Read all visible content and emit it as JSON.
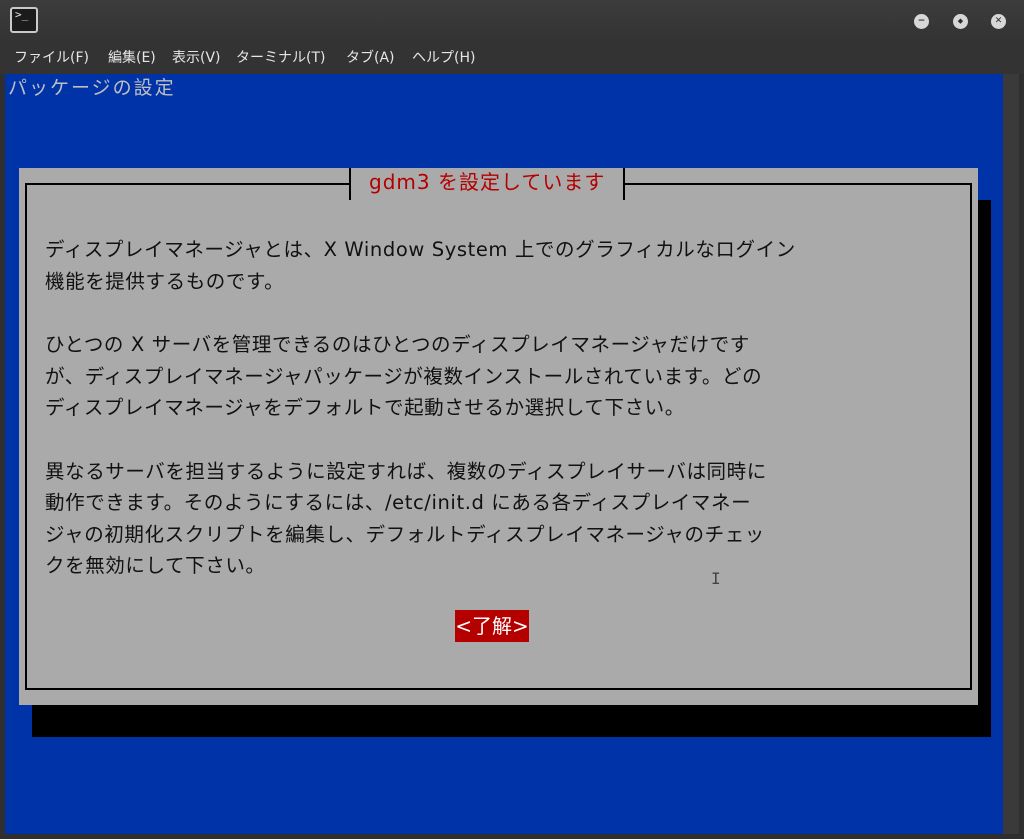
{
  "window": {
    "icon_glyph": ">_",
    "controls": {
      "minimize_glyph": "−",
      "maximize_glyph": "◆",
      "close_glyph": "✕"
    }
  },
  "menubar": {
    "items": [
      {
        "label": "ファイル(F)"
      },
      {
        "label": "編集(E)"
      },
      {
        "label": "表示(V)"
      },
      {
        "label": "ターミナル(T)"
      },
      {
        "label": "タブ(A)"
      },
      {
        "label": "ヘルプ(H)"
      }
    ]
  },
  "terminal": {
    "backtitle": "パッケージの設定",
    "dialog": {
      "title": "gdm3 を設定しています",
      "paragraphs": [
        "ディスプレイマネージャとは、X Window System 上でのグラフィカルなログイン\n機能を提供するものです。",
        "ひとつの X サーバを管理できるのはひとつのディスプレイマネージャだけです\nが、ディスプレイマネージャパッケージが複数インストールされています。どの\nディスプレイマネージャをデフォルトで起動させるか選択して下さい。",
        "異なるサーバを担当するように設定すれば、複数のディスプレイサーバは同時に\n動作できます。そのようにするには、/etc/init.d にある各ディスプレイマネー\nジャの初期化スクリプトを編集し、デフォルトディスプレイマネージャのチェッ\nクを無効にして下さい。"
      ],
      "ok_label": "<了解>"
    }
  },
  "colors": {
    "terminal_bg": "#0033a8",
    "dialog_bg": "#aaaaaa",
    "accent_red": "#b50000"
  }
}
